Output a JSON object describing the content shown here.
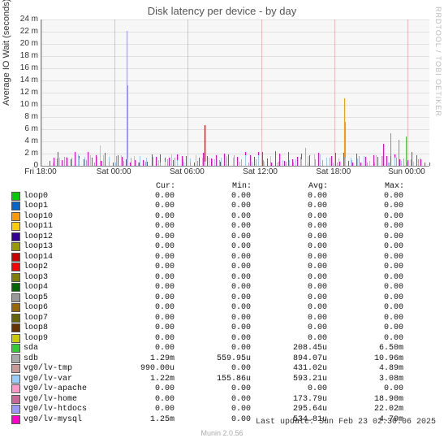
{
  "title": "Disk latency per device - by day",
  "yaxis": "Average IO Wait (seconds)",
  "watermark": "RRDTOOL / TOBI OETIKER",
  "footer_update": "Last update: Sun Feb 23 02:30:06 2025",
  "footer_tool": "Munin 2.0.56",
  "chart_data": {
    "type": "line",
    "xlabel": "",
    "ylabel": "Average IO Wait (seconds)",
    "ylim": [
      0,
      0.024
    ],
    "yticks": [
      "0",
      "2 m",
      "4 m",
      "6 m",
      "8 m",
      "10 m",
      "12 m",
      "14 m",
      "16 m",
      "18 m",
      "20 m",
      "22 m",
      "24 m"
    ],
    "xticks": [
      "Fri 18:00",
      "Sat 00:00",
      "Sat 06:00",
      "Sat 12:00",
      "Sat 18:00",
      "Sun 00:00"
    ],
    "series_note": "Highly spiky multi-series latency; peak ~22m vg0/lv-htdocs near Sat 01:00, ~11m peak near Sat 18:30, ~6.5m sda, dense low-ms activity across full range"
  },
  "columns": {
    "cur": "Cur:",
    "min": "Min:",
    "avg": "Avg:",
    "max": "Max:"
  },
  "devices": [
    {
      "name": "loop0",
      "color": "#00cc00",
      "cur": "0.00",
      "min": "0.00",
      "avg": "0.00",
      "max": "0.00"
    },
    {
      "name": "loop1",
      "color": "#0066cc",
      "cur": "0.00",
      "min": "0.00",
      "avg": "0.00",
      "max": "0.00"
    },
    {
      "name": "loop10",
      "color": "#ff9900",
      "cur": "0.00",
      "min": "0.00",
      "avg": "0.00",
      "max": "0.00"
    },
    {
      "name": "loop11",
      "color": "#ffcc00",
      "cur": "0.00",
      "min": "0.00",
      "avg": "0.00",
      "max": "0.00"
    },
    {
      "name": "loop12",
      "color": "#330099",
      "cur": "0.00",
      "min": "0.00",
      "avg": "0.00",
      "max": "0.00"
    },
    {
      "name": "loop13",
      "color": "#999900",
      "cur": "0.00",
      "min": "0.00",
      "avg": "0.00",
      "max": "0.00"
    },
    {
      "name": "loop14",
      "color": "#cc0000",
      "cur": "0.00",
      "min": "0.00",
      "avg": "0.00",
      "max": "0.00"
    },
    {
      "name": "loop2",
      "color": "#ff0000",
      "cur": "0.00",
      "min": "0.00",
      "avg": "0.00",
      "max": "0.00"
    },
    {
      "name": "loop3",
      "color": "#808000",
      "cur": "0.00",
      "min": "0.00",
      "avg": "0.00",
      "max": "0.00"
    },
    {
      "name": "loop4",
      "color": "#006600",
      "cur": "0.00",
      "min": "0.00",
      "avg": "0.00",
      "max": "0.00"
    },
    {
      "name": "loop5",
      "color": "#999999",
      "cur": "0.00",
      "min": "0.00",
      "avg": "0.00",
      "max": "0.00"
    },
    {
      "name": "loop6",
      "color": "#996600",
      "cur": "0.00",
      "min": "0.00",
      "avg": "0.00",
      "max": "0.00"
    },
    {
      "name": "loop7",
      "color": "#666600",
      "cur": "0.00",
      "min": "0.00",
      "avg": "0.00",
      "max": "0.00"
    },
    {
      "name": "loop8",
      "color": "#663300",
      "cur": "0.00",
      "min": "0.00",
      "avg": "0.00",
      "max": "0.00"
    },
    {
      "name": "loop9",
      "color": "#cccc00",
      "cur": "0.00",
      "min": "0.00",
      "avg": "0.00",
      "max": "0.00"
    },
    {
      "name": "sda",
      "color": "#33cc33",
      "cur": "0.00",
      "min": "0.00",
      "avg": "208.45u",
      "max": "6.50m"
    },
    {
      "name": "sdb",
      "color": "#aaaaaa",
      "cur": "1.29m",
      "min": "559.95u",
      "avg": "894.07u",
      "max": "10.96m"
    },
    {
      "name": "vg0/lv-tmp",
      "color": "#cc9999",
      "cur": "990.00u",
      "min": "0.00",
      "avg": "431.02u",
      "max": "4.89m"
    },
    {
      "name": "vg0/lv-var",
      "color": "#99ccff",
      "cur": "1.22m",
      "min": "155.86u",
      "avg": "593.21u",
      "max": "3.08m"
    },
    {
      "name": "vg0/lv-apache",
      "color": "#ff99cc",
      "cur": "0.00",
      "min": "0.00",
      "avg": "0.00",
      "max": "0.00"
    },
    {
      "name": "vg0/lv-home",
      "color": "#cc6699",
      "cur": "0.00",
      "min": "0.00",
      "avg": "173.79u",
      "max": "18.90m"
    },
    {
      "name": "vg0/lv-htdocs",
      "color": "#9999ff",
      "cur": "0.00",
      "min": "0.00",
      "avg": "295.64u",
      "max": "22.02m"
    },
    {
      "name": "vg0/lv-mysql",
      "color": "#ff00cc",
      "cur": "1.25m",
      "min": "0.00",
      "avg": "534.81u",
      "max": "4.70m"
    }
  ]
}
